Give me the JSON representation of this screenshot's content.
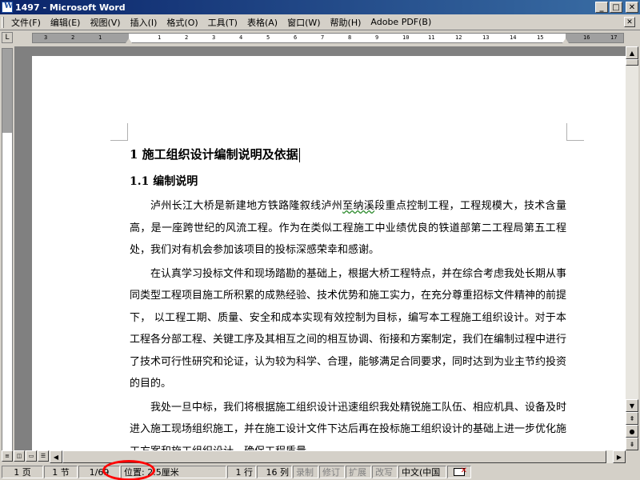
{
  "window": {
    "title": "1497 - Microsoft Word",
    "minimize": "_",
    "maximize": "□",
    "close": "✕"
  },
  "menu": {
    "items": [
      "文件(F)",
      "编辑(E)",
      "视图(V)",
      "插入(I)",
      "格式(O)",
      "工具(T)",
      "表格(A)",
      "窗口(W)",
      "帮助(H)",
      "Adobe PDF(B)"
    ],
    "doc_close": "✕"
  },
  "ruler": {
    "numbers": [
      "3",
      "2",
      "1",
      "1",
      "2",
      "3",
      "4",
      "5",
      "6",
      "7",
      "8",
      "9",
      "10",
      "11",
      "12",
      "13",
      "14",
      "15",
      "16",
      "17"
    ]
  },
  "document": {
    "heading1": "1  施工组织设计编制说明及依据",
    "heading2": "1.1 编制说明",
    "para1_a": "泸州长江大桥是新建地方铁路隆叙线泸州",
    "para1_spell": "至纳溪",
    "para1_b": "段重点控制工程，工程规模大，技术含量高，是一座跨世纪的风流工程。作为在类似工程施工中业绩优良的铁道部第二工程局第五工程处，我们对有机会参加该项目的投标深感荣幸和感谢。",
    "para2": "在认真学习投标文件和现场踏勘的基础上，根据大桥工程特点，并在综合考虑我处长期从事同类型工程项目施工所积累的成熟经验、技术优势和施工实力，在充分尊重招标文件精神的前提下， 以工程工期、质量、安全和成本实现有效控制为目标，编写本工程施工组织设计。对于本工程各分部工程、关键工序及其相互之间的相互协调、衔接和方案制定，我们在编制过程中进行了技术可行性研究和论证，认为较为科学、合理，能够满足合同要求，同时达到为业主节约投资的目的。",
    "para3": "我处一旦中标，我们将根据施工组织设计迅速组织我处精锐施工队伍、相应机具、设备及时进入施工现场组织施工，并在施工设计文件下达后再在投标施工组织设计的基础上进一步优化施工方案和施工组织设计，确保工程质量。"
  },
  "statusbar": {
    "page": "1 页",
    "section": "1 节",
    "page_of": "1/69",
    "position": "位置: 2.5厘米",
    "line": "1 行",
    "col": "16 列",
    "rec": "录制",
    "trk": "修订",
    "ext": "扩展",
    "ovr": "改写",
    "lang": "中文(中国"
  }
}
